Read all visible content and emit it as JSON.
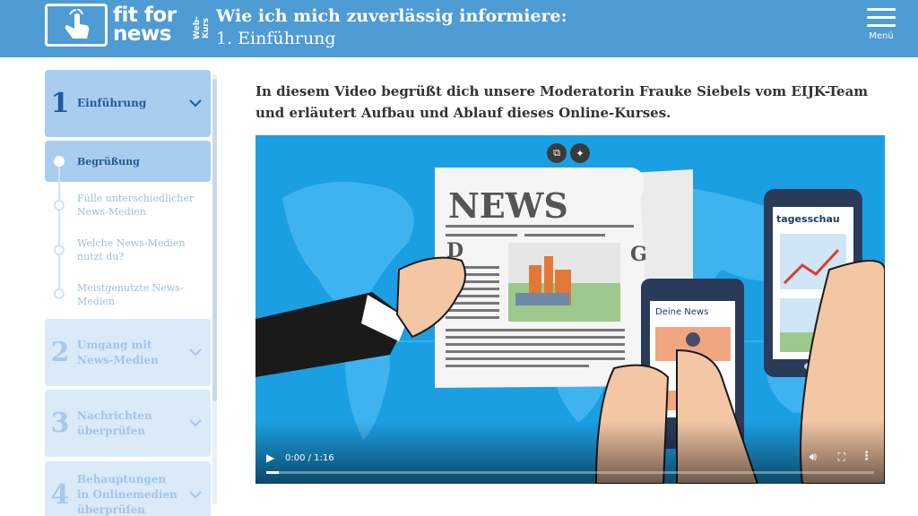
{
  "header": {
    "logo_text_line1": "fit for",
    "logo_text_line2": "news",
    "logo_side_text": "Web-Kurs",
    "title": "Wie ich mich zuverlässig informiere:",
    "subtitle": "1. Einführung",
    "menu_label": "Menü",
    "color": "#4f9bd3"
  },
  "sidebar": {
    "chapters": [
      {
        "num": "1",
        "label": "Einführung",
        "active": true
      },
      {
        "num": "2",
        "label": "Umgang mit News-Medien"
      },
      {
        "num": "3",
        "label": "Nachrichten überprüfen"
      },
      {
        "num": "4",
        "label": "Behauptungen in Onlinemedien überprüfen"
      }
    ],
    "lessons": [
      {
        "label": "Begrüßung",
        "active": true
      },
      {
        "label": "Fülle unterschiedlicher News-Medien"
      },
      {
        "label": "Welche News-Medien nutzt du?"
      },
      {
        "label": "Meistgenutzte News-Medien"
      }
    ]
  },
  "main": {
    "intro": "In diesem Video begrüßt dich unsere Moderatorin Frauke Siebels vom EIJK-Team und erläutert Aufbau und Ablauf dieses Online-Kurses.",
    "video": {
      "time": "0:00 / 1:16",
      "progress": 0.02,
      "newspaper_title": "NEWS",
      "newspaper_letters": [
        "D",
        "G"
      ],
      "phone_small_label": "Deine News",
      "phone_large_label": "tagesschau"
    }
  },
  "icons": [
    "hand-tap-icon",
    "menu-icon",
    "chevron-down-icon",
    "pip-icon",
    "sparkle-icon",
    "play-icon",
    "volume-icon",
    "fullscreen-icon",
    "more-icon"
  ]
}
